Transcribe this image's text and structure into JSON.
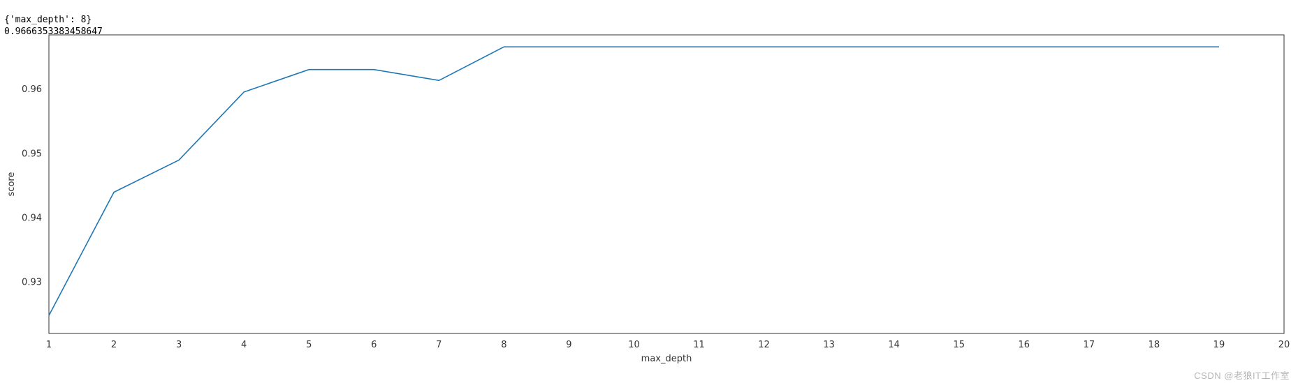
{
  "output": {
    "line1": "{'max_depth': 8}",
    "line2": "0.9666353383458647"
  },
  "watermark": "CSDN @老狼IT工作室",
  "chart_data": {
    "type": "line",
    "xlabel": "max_depth",
    "ylabel": "score",
    "title": "",
    "xlim": [
      1,
      20
    ],
    "ylim": [
      0.922,
      0.9685
    ],
    "xticks": [
      1,
      2,
      3,
      4,
      5,
      6,
      7,
      8,
      9,
      10,
      11,
      12,
      13,
      14,
      15,
      16,
      17,
      18,
      19,
      20
    ],
    "yticks": [
      0.93,
      0.94,
      0.95,
      0.96
    ],
    "x": [
      1,
      2,
      3,
      4,
      5,
      6,
      7,
      8,
      9,
      10,
      11,
      12,
      13,
      14,
      15,
      16,
      17,
      18,
      19
    ],
    "y": [
      0.9248,
      0.944,
      0.949,
      0.9596,
      0.9631,
      0.9631,
      0.9614,
      0.96664,
      0.96664,
      0.96664,
      0.96664,
      0.96664,
      0.96664,
      0.96664,
      0.96664,
      0.96664,
      0.96664,
      0.96664,
      0.96664
    ],
    "color": "#1f77b4"
  }
}
